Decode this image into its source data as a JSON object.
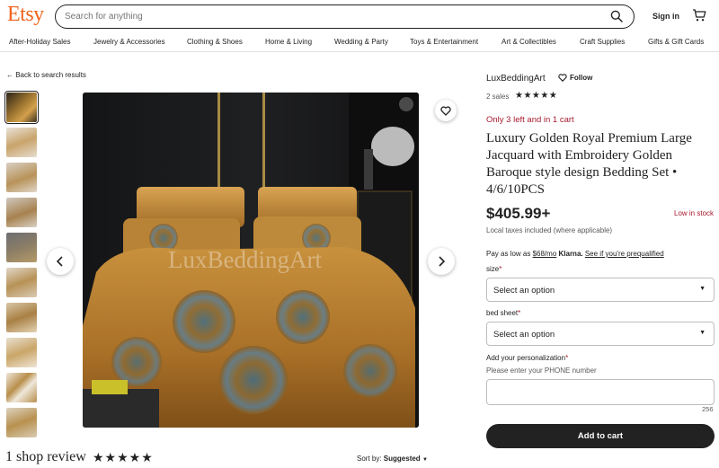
{
  "header": {
    "logo": "Etsy",
    "search_placeholder": "Search for anything",
    "signin_label": "Sign in"
  },
  "categories": [
    "After-Holiday Sales",
    "Jewelry & Accessories",
    "Clothing & Shoes",
    "Home & Living",
    "Wedding & Party",
    "Toys & Entertainment",
    "Art & Collectibles",
    "Craft Supplies",
    "Gifts & Gift Cards"
  ],
  "back_link": "← Back to search results",
  "image": {
    "watermark": "LuxBeddingArt",
    "thumbnail_count": 10,
    "selected_thumbnail": 1
  },
  "listing": {
    "shop_name": "LuxBeddingArt",
    "follow_label": "Follow",
    "sales": "2 sales",
    "shop_rating": 5,
    "scarcity": "Only 3 left and in 1 cart",
    "title": "Luxury Golden Royal Premium Large Jacquard with Embroidery Golden Baroque style design Bedding Set • 4/6/10PCS",
    "price": "$405.99+",
    "stock_status": "Low in stock",
    "taxes": "Local taxes included (where applicable)",
    "klarna_prefix": "Pay as low as ",
    "klarna_amount": "$68/mo",
    "klarna_brand": " Klarna.",
    "klarna_link": "See if you're prequalified"
  },
  "options": {
    "size_label": "size",
    "size_value": "Select an option",
    "bedsheet_label": "bed sheet",
    "bedsheet_value": "Select an option",
    "required_marker": "*"
  },
  "personalization": {
    "label": "Add your personalization",
    "hint": "Please enter your PHONE number",
    "value": "",
    "char_remaining": "256"
  },
  "add_to_cart_label": "Add to cart",
  "reviews": {
    "title": "1 shop review",
    "rating": 5,
    "sort_prefix": "Sort by: ",
    "sort_value": "Suggested"
  },
  "colors": {
    "brand": "#f1641e",
    "alert": "#a61a2e",
    "dark": "#222222"
  }
}
